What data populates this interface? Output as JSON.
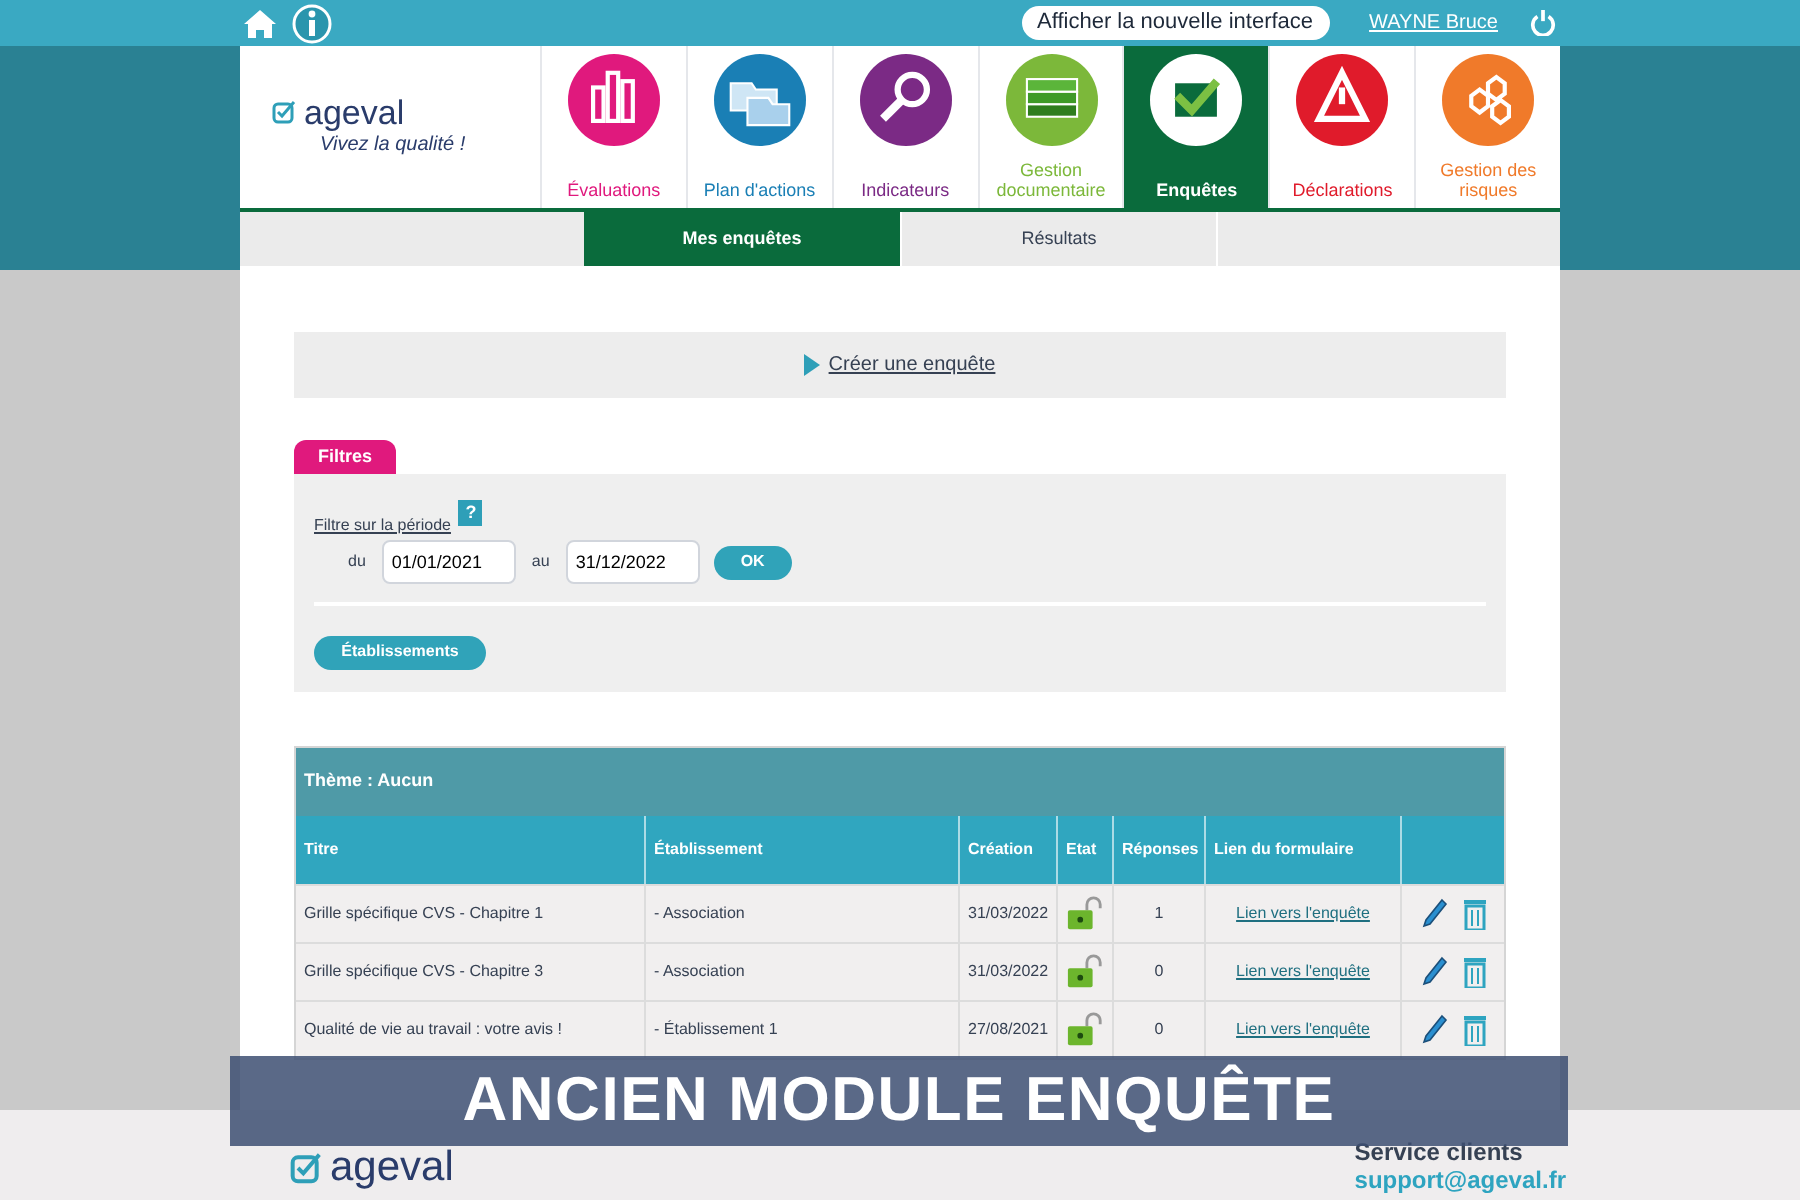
{
  "top_bar": {
    "new_interface_button": "Afficher la nouvelle interface",
    "user": "WAYNE Bruce"
  },
  "logo": {
    "name": "ageval",
    "tagline": "Vivez la qualité !"
  },
  "modules": [
    {
      "label": "Évaluations",
      "color": "#e0197d",
      "selected": false
    },
    {
      "label": "Plan d'actions",
      "color": "#1a7fb5",
      "selected": false
    },
    {
      "label": "Indicateurs",
      "color": "#7b2a85",
      "selected": false
    },
    {
      "label": "Gestion documentaire",
      "color": "#7cb83a",
      "selected": false
    },
    {
      "label": "Enquêtes",
      "color": "#0a6b3c",
      "selected": true
    },
    {
      "label": "Déclarations",
      "color": "#e01b2b",
      "selected": false
    },
    {
      "label": "Gestion des risques",
      "color": "#f07a2a",
      "selected": false
    }
  ],
  "subtabs": [
    {
      "label": "Mes enquêtes",
      "selected": true
    },
    {
      "label": "Résultats",
      "selected": false
    }
  ],
  "create_link": "Créer une enquête",
  "filters": {
    "tab": "Filtres",
    "period_label": "Filtre sur la période",
    "help": "?",
    "from_label": "du",
    "from": "01/01/2021",
    "to_label": "au",
    "to": "31/12/2022",
    "ok": "OK",
    "establishments_button": "Établissements"
  },
  "table": {
    "theme": "Thème : Aucun",
    "columns": [
      "Titre",
      "Établissement",
      "Création",
      "Etat",
      "Réponses",
      "Lien du formulaire"
    ],
    "rows": [
      {
        "title": "Grille spécifique CVS - Chapitre 1",
        "establishment": "- Association",
        "created": "31/03/2022",
        "open": true,
        "responses": "1",
        "link": "Lien vers l'enquête"
      },
      {
        "title": "Grille spécifique CVS - Chapitre 3",
        "establishment": "- Association",
        "created": "31/03/2022",
        "open": true,
        "responses": "0",
        "link": "Lien vers l'enquête"
      },
      {
        "title": "Qualité de vie au travail : votre avis !",
        "establishment": "- Établissement 1",
        "created": "27/08/2021",
        "open": true,
        "responses": "0",
        "link": "Lien vers l'enquête"
      }
    ]
  },
  "banner": "ANCIEN MODULE ENQUÊTE",
  "footer": {
    "logo": "ageval",
    "service_title": "Service clients",
    "email": "support@ageval.fr"
  }
}
